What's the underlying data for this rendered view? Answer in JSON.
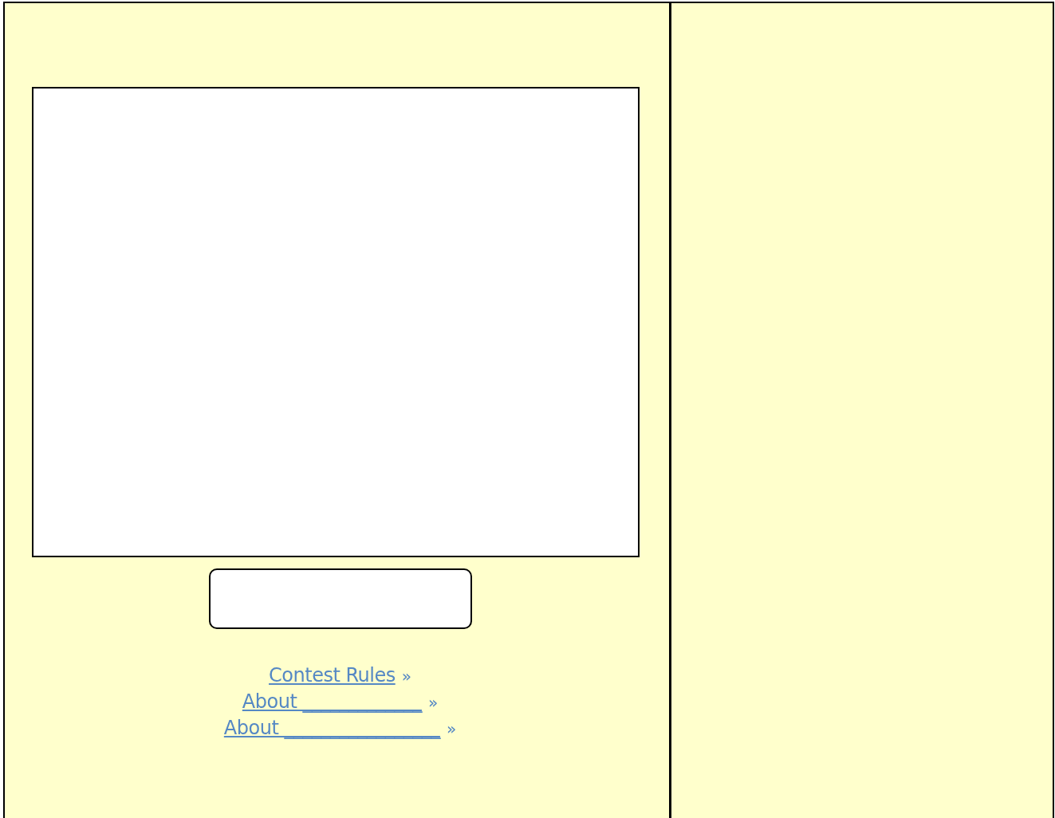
{
  "links": [
    {
      "label": "Contest Rules",
      "suffix": "»"
    },
    {
      "label": "About _____________",
      "suffix": "»"
    },
    {
      "label": "About _________________",
      "suffix": "»"
    }
  ]
}
